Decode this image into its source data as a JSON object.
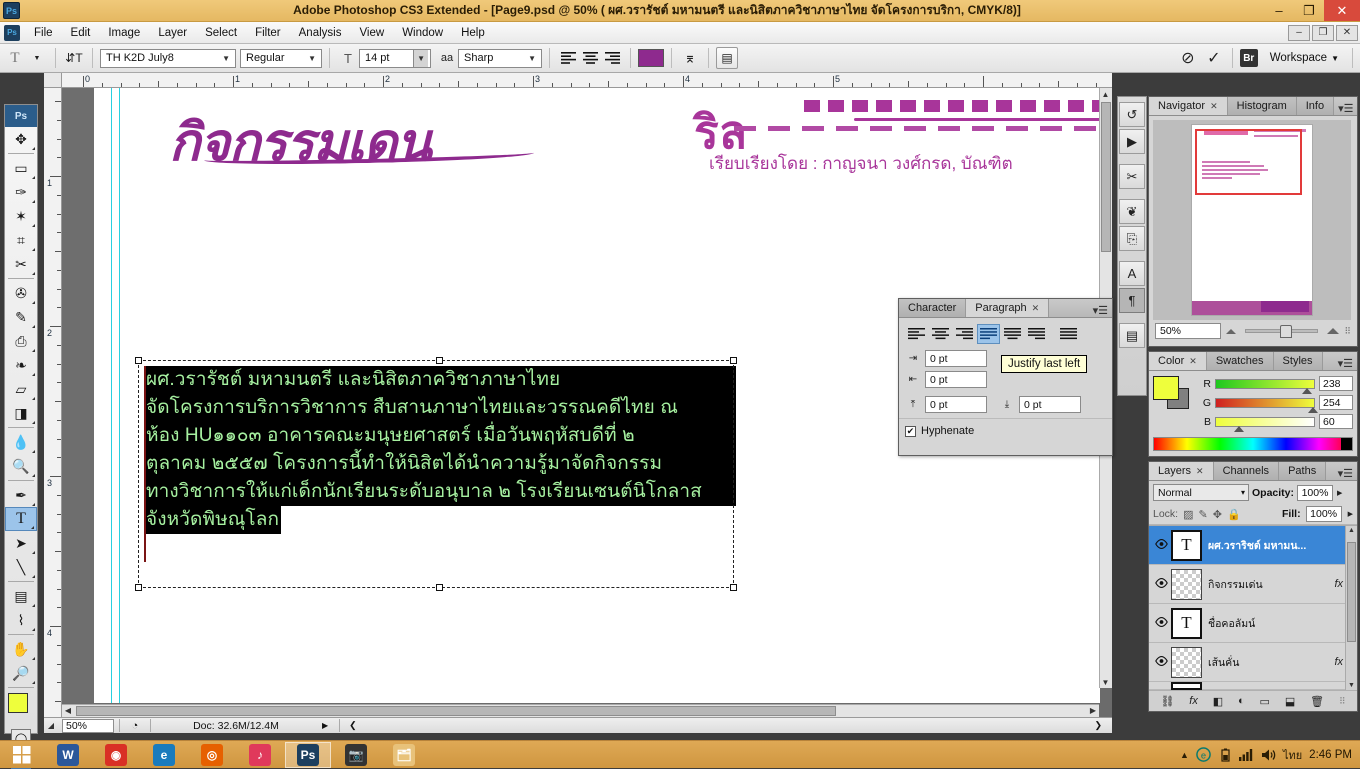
{
  "window": {
    "app_title": "Adobe Photoshop CS3 Extended - [Page9.psd @ 50% (  ผศ.วรารัชต์  มหามนตรี และนิสิตภาควิชาภาษาไทย จัดโครงการบริกา, CMYK/8)]",
    "minimize": "–",
    "restore": "❐",
    "close": "✕",
    "doc_minimize": "–",
    "doc_restore": "❐",
    "doc_close": "✕"
  },
  "menu": {
    "items": [
      "File",
      "Edit",
      "Image",
      "Layer",
      "Select",
      "Filter",
      "Analysis",
      "View",
      "Window",
      "Help"
    ]
  },
  "options_bar": {
    "tool_icon": "T",
    "orientation_icon": "⇵T",
    "font_family": "TH K2D July8",
    "font_style": "Regular",
    "font_size": "14 pt",
    "aa_label": "aa",
    "anti_alias": "Sharp",
    "align_left": "align-left",
    "align_center": "align-center",
    "align_right": "align-right",
    "color_swatch": "#8e2a8e",
    "cancel_icon": "⊘",
    "commit_icon": "✓",
    "bridge_icon": "Br",
    "workspace_label": "Workspace",
    "workspace_arrow": "▼",
    "warp_icon": "warp-text",
    "palette_icon": "character-palette"
  },
  "toolbox": {
    "logo": "Ps",
    "tools": [
      {
        "name": "move-tool",
        "glyph": "✥"
      },
      {
        "name": "marquee-tool",
        "glyph": "▭"
      },
      {
        "name": "lasso-tool",
        "glyph": "✑"
      },
      {
        "name": "magic-wand-tool",
        "glyph": "✶"
      },
      {
        "name": "crop-tool",
        "glyph": "⌗"
      },
      {
        "name": "slice-tool",
        "glyph": "✂"
      },
      {
        "name": "healing-brush-tool",
        "glyph": "✇"
      },
      {
        "name": "brush-tool",
        "glyph": "✎"
      },
      {
        "name": "clone-stamp-tool",
        "glyph": "⎙"
      },
      {
        "name": "history-brush-tool",
        "glyph": "❧"
      },
      {
        "name": "eraser-tool",
        "glyph": "▱"
      },
      {
        "name": "gradient-tool",
        "glyph": "◨"
      },
      {
        "name": "blur-tool",
        "glyph": "💧"
      },
      {
        "name": "dodge-tool",
        "glyph": "🔍"
      },
      {
        "name": "pen-tool",
        "glyph": "✒"
      },
      {
        "name": "type-tool",
        "glyph": "T",
        "selected": true
      },
      {
        "name": "path-selection-tool",
        "glyph": "➤"
      },
      {
        "name": "line-tool",
        "glyph": "╲"
      },
      {
        "name": "notes-tool",
        "glyph": "▤"
      },
      {
        "name": "eyedropper-tool",
        "glyph": "⌇"
      },
      {
        "name": "hand-tool",
        "glyph": "✋"
      },
      {
        "name": "zoom-tool",
        "glyph": "🔎"
      }
    ],
    "foreground_color": "#eefe3c",
    "background_color": "#808080",
    "quickmask_standard": "◯",
    "screenmode": "▣"
  },
  "document": {
    "ruler_unit": "inches",
    "ruler_h_marks": [
      "0",
      "1",
      "2",
      "3",
      "4",
      "5"
    ],
    "ruler_v_marks": [
      "1",
      "2",
      "3",
      "4"
    ],
    "headline": "กิจกรรมเดน",
    "headline_right_fragment": "ริล",
    "byline": "เรียบเรียงโดย :  กาญจนา   วงศ์กรด, บัณฑิต",
    "text_lines": [
      "    ผศ.วรารัชต์          มหามนตรี      และนิสิตภาควิชาภาษาไทย",
      "จัดโครงการบริการวิชาการ    สืบสานภาษาไทยและวรรณคดีไทย    ณ",
      "ห้อง   HU๑๑๐๓   อาคารคณะมนุษยศาสตร์   เมื่อวันพฤหัสบดีที่   ๒",
      "ตุลาคม   ๒๕๕๗       โครงการนี้ทำให้นิสิตได้นำความรู้มาจัดกิจกรรม",
      "ทางวิชาการให้แก่เด็กนักเรียนระดับอนุบาล  ๒  โรงเรียนเซนต์นิโกลาส",
      "จังหวัดพิษณุโลก"
    ],
    "status_zoom": "50%",
    "status_doc": "Doc: 32.6M/12.4M",
    "status_arrow": "▶",
    "status_prev": "❮",
    "status_next": "❯"
  },
  "paragraph_panel": {
    "tabs": [
      {
        "label": "Character",
        "active": false,
        "closable": false
      },
      {
        "label": "Paragraph",
        "active": true,
        "closable": true,
        "close": "✕"
      }
    ],
    "menu_icon": "▾☰",
    "align_buttons": [
      {
        "name": "align-left",
        "active": false
      },
      {
        "name": "align-center",
        "active": false
      },
      {
        "name": "align-right",
        "active": false
      },
      {
        "name": "justify-last-left",
        "active": true
      },
      {
        "name": "justify-last-center",
        "active": false
      },
      {
        "name": "justify-last-right",
        "active": false
      },
      {
        "name": "justify-all",
        "active": false
      }
    ],
    "tooltip": "Justify last left",
    "indent_left": "0 pt",
    "indent_right": "0 pt",
    "indent_first_line": "0 pt",
    "space_before": "0 pt",
    "space_after": "0 pt",
    "hyphenate_label": "Hyphenate",
    "hyphenate_checked": "✔"
  },
  "icon_dock": [
    {
      "name": "history-icon",
      "glyph": "↺"
    },
    {
      "name": "actions-icon",
      "glyph": "▶"
    },
    {
      "name": "tool-presets-icon",
      "glyph": "✂"
    },
    {
      "name": "brushes-icon",
      "glyph": "❦"
    },
    {
      "name": "clone-source-icon",
      "glyph": "⎘"
    },
    {
      "name": "character-icon",
      "glyph": "A"
    },
    {
      "name": "paragraph-icon",
      "glyph": "¶",
      "active": true
    },
    {
      "name": "layer-comps-icon",
      "glyph": "▤"
    }
  ],
  "navigator_panel": {
    "tabs": [
      {
        "label": "Navigator",
        "active": true,
        "close": "✕"
      },
      {
        "label": "Histogram",
        "active": false
      },
      {
        "label": "Info",
        "active": false
      }
    ],
    "menu_icon": "▾☰",
    "zoom_value": "50%",
    "zoom_out_icon": "small-mountain",
    "zoom_in_icon": "large-mountain"
  },
  "color_panel": {
    "tabs": [
      {
        "label": "Color",
        "active": true,
        "close": "✕"
      },
      {
        "label": "Swatches",
        "active": false
      },
      {
        "label": "Styles",
        "active": false
      }
    ],
    "menu_icon": "▾☰",
    "foreground": "#eefe3c",
    "background": "#808080",
    "channels": [
      {
        "label": "R",
        "value": "238",
        "pos": 93
      },
      {
        "label": "G",
        "value": "254",
        "pos": 99
      },
      {
        "label": "B",
        "value": "60",
        "pos": 23
      }
    ]
  },
  "layers_panel": {
    "tabs": [
      {
        "label": "Layers",
        "active": true,
        "close": "✕"
      },
      {
        "label": "Channels",
        "active": false
      },
      {
        "label": "Paths",
        "active": false
      }
    ],
    "menu_icon": "▾☰",
    "blend_mode": "Normal",
    "blend_arrow": "▾",
    "opacity_label": "Opacity:",
    "opacity_value": "100%",
    "lock_label": "Lock:",
    "lock_icons": [
      "transparency-lock",
      "paint-lock",
      "position-lock",
      "all-lock"
    ],
    "fill_label": "Fill:",
    "fill_value": "100%",
    "layers": [
      {
        "name": "ผศ.วราริชต์  มหามน...",
        "type": "text",
        "selected": true,
        "fx": false,
        "visible": "👁"
      },
      {
        "name": "กิจกรรมเด่น",
        "type": "pixel",
        "selected": false,
        "fx": true,
        "visible": "👁"
      },
      {
        "name": "ชื่อคอลัมน์",
        "type": "text",
        "selected": false,
        "fx": false,
        "visible": "👁"
      },
      {
        "name": "เส้นคั่น",
        "type": "pixel",
        "selected": false,
        "fx": true,
        "visible": "👁"
      }
    ],
    "footer_icons": [
      {
        "name": "link-layers-icon",
        "glyph": "⛓"
      },
      {
        "name": "layer-style-icon",
        "glyph": "fx"
      },
      {
        "name": "layer-mask-icon",
        "glyph": "◧"
      },
      {
        "name": "adjustment-layer-icon",
        "glyph": "◐"
      },
      {
        "name": "new-group-icon",
        "glyph": "▭"
      },
      {
        "name": "new-layer-icon",
        "glyph": "⬓"
      },
      {
        "name": "delete-layer-icon",
        "glyph": "🗑"
      }
    ]
  },
  "taskbar": {
    "start_icon": "⊞",
    "apps": [
      {
        "name": "word-taskbar-icon",
        "glyph": "W",
        "active": false
      },
      {
        "name": "chrome-taskbar-icon",
        "glyph": "◉",
        "active": false
      },
      {
        "name": "ie-taskbar-icon",
        "glyph": "e",
        "active": false
      },
      {
        "name": "firefox-taskbar-icon",
        "glyph": "◎",
        "active": false
      },
      {
        "name": "itunes-taskbar-icon",
        "glyph": "♪",
        "active": false
      },
      {
        "name": "photoshop-taskbar-icon",
        "glyph": "Ps",
        "active": true
      },
      {
        "name": "camera-taskbar-icon",
        "glyph": "📷",
        "active": false
      },
      {
        "name": "explorer-taskbar-icon",
        "glyph": "🗂",
        "active": false
      }
    ],
    "tray": {
      "overflow_icon": "▲",
      "edge_icon": "e",
      "battery_icon": "battery",
      "signal_icon": "signal",
      "volume_icon": "🔊",
      "language": "ไทย",
      "clock": "2:46 PM"
    }
  }
}
